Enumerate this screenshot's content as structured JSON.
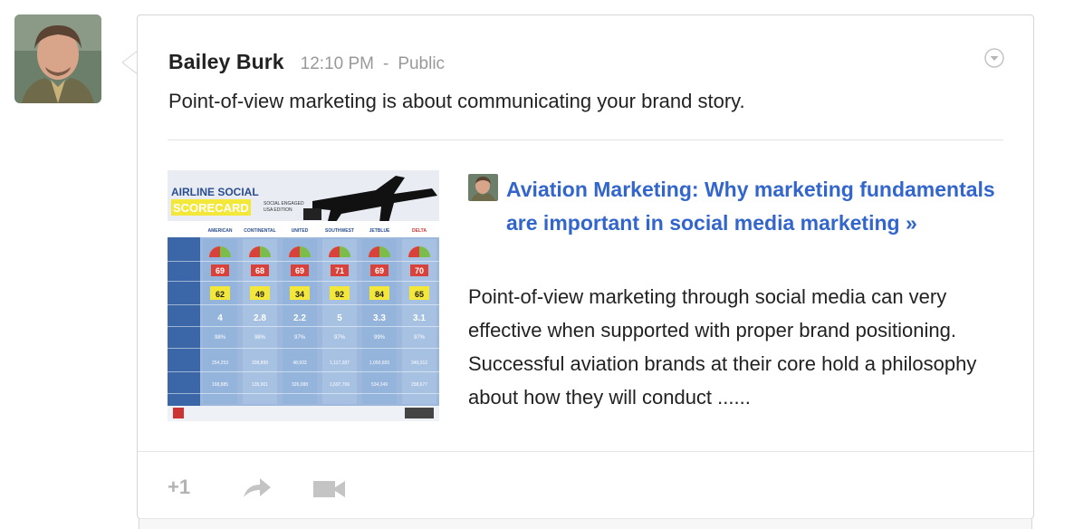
{
  "post": {
    "author": "Bailey Burk",
    "time": "12:10 PM",
    "separator": "-",
    "visibility": "Public",
    "text": "Point-of-view marketing is about communicating your brand story."
  },
  "link": {
    "title": "Aviation Marketing: Why marketing fundamentals are important in social media marketing »",
    "description": "Point-of-view marketing through social media can very effective when supported with proper brand positioning. Successful aviation brands at their core hold a philosophy about how they will conduct ......"
  },
  "thumbnail": {
    "title_line1": "AIRLINE SOCIAL",
    "title_line2": "SCORECARD",
    "subtitle": "SOCIAL ENGAGED",
    "subtitle2": "USA EDITION",
    "airlines": [
      "AMERICAN",
      "CONTINENTAL",
      "UNITED",
      "SOUTHWEST",
      "JETBLUE",
      "DELTA"
    ],
    "row1": [
      "69",
      "68",
      "69",
      "71",
      "69",
      "70"
    ],
    "row2": [
      "62",
      "49",
      "34",
      "92",
      "84",
      "65"
    ],
    "row3": [
      "4",
      "2.8",
      "2.2",
      "5",
      "3.3",
      "3.1"
    ],
    "row4": [
      "98%",
      "98%",
      "97%",
      "97%",
      "99%",
      "97%"
    ],
    "row5": [
      "254,253",
      "208,899",
      "48,933",
      "1,117,287",
      "1,050,655",
      "349,312"
    ],
    "row6": [
      "168,885",
      "135,901",
      "326,088",
      "1,697,706",
      "534,349",
      "258,677"
    ]
  },
  "footer": {
    "plusone": "+1"
  },
  "colors": {
    "link": "#3366cc",
    "meta": "#999999",
    "text": "#222222",
    "thumb_blue": "#5b86c2",
    "thumb_yellow": "#f3e73a"
  },
  "icons": {
    "menu": "chevron-down-circle-icon",
    "share": "share-arrow-icon",
    "hangout": "video-camera-icon"
  }
}
